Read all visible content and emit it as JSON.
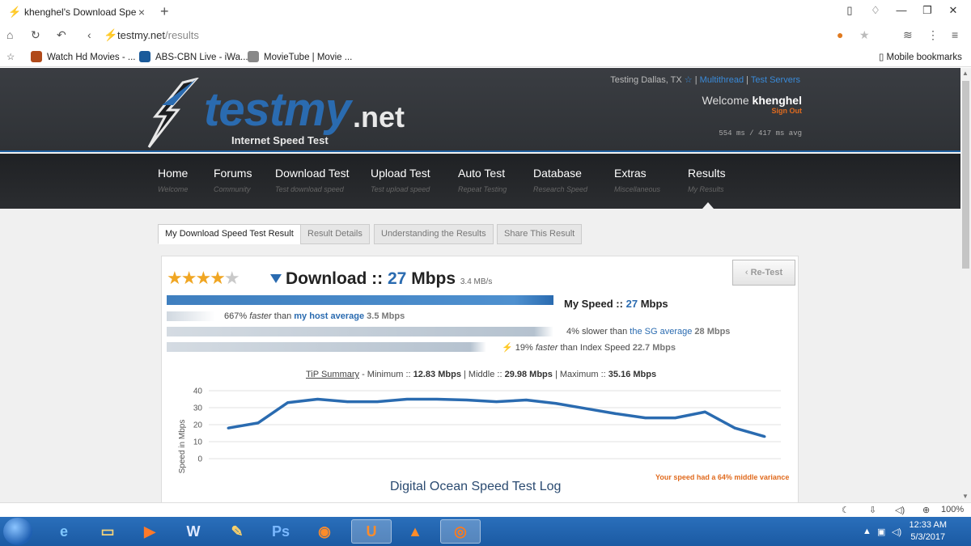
{
  "browser": {
    "tab_title": "khenghel's Download Speed T",
    "url_host": "testmy.net",
    "url_path": "/results",
    "bookmarks": [
      {
        "label": "Watch Hd Movies - ..."
      },
      {
        "label": "ABS-CBN Live - iWa..."
      },
      {
        "label": "MovieTube | Movie ..."
      }
    ],
    "mobile_bookmarks": "Mobile bookmarks",
    "zoom": "100%"
  },
  "header": {
    "logo_main": "testmy",
    "logo_net": ".net",
    "logo_sub": "Internet Speed Test",
    "testing_location": "Testing Dallas, TX",
    "multithread": "Multithread",
    "test_servers": "Test Servers",
    "welcome_prefix": "Welcome",
    "username": "khenghel",
    "sign_out": "Sign Out",
    "ping": "554 ms / 417 ms avg"
  },
  "menu": [
    {
      "label": "Home",
      "sub": "Welcome"
    },
    {
      "label": "Forums",
      "sub": "Community"
    },
    {
      "label": "Download Test",
      "sub": "Test download speed"
    },
    {
      "label": "Upload Test",
      "sub": "Test upload speed"
    },
    {
      "label": "Auto Test",
      "sub": "Repeat Testing"
    },
    {
      "label": "Database",
      "sub": "Research Speed"
    },
    {
      "label": "Extras",
      "sub": "Miscellaneous"
    },
    {
      "label": "Results",
      "sub": "My Results"
    }
  ],
  "result_tabs": [
    {
      "label": "My Download Speed Test Result",
      "active": true
    },
    {
      "label": "Result Details",
      "active": false
    },
    {
      "label": "Understanding the Results",
      "active": false
    },
    {
      "label": "Share This Result",
      "active": false
    }
  ],
  "result": {
    "rating_stars": 4.5,
    "title_prefix": "Download ::",
    "speed_value": "27",
    "speed_unit": "Mbps",
    "speed_mbs": "3.4 MB/s",
    "retest": "Re-Test",
    "my_speed_label": "My Speed ::",
    "my_speed_value": "27",
    "my_speed_unit": "Mbps",
    "host_compare": {
      "pct": "667%",
      "word": "faster",
      "mid": "than",
      "link": "my host average",
      "value": "3.5 Mbps"
    },
    "sg_compare": {
      "text": "4% slower than",
      "link": "the SG average",
      "value": "28 Mbps"
    },
    "index_compare": {
      "pct": "19%",
      "word": "faster",
      "mid": "than Index Speed",
      "value": "22.7 Mbps"
    },
    "tip_label": "TiP Summary",
    "tip_min_label": "- Minimum ::",
    "tip_min": "12.83 Mbps",
    "tip_mid_label": "| Middle ::",
    "tip_mid": "29.98 Mbps",
    "tip_max_label": "| Maximum ::",
    "tip_max": "35.16 Mbps",
    "variance_note": "Your speed had a 64% middle variance",
    "log_title": "Digital Ocean Speed Test Log"
  },
  "chart_data": {
    "type": "line",
    "ylabel": "Speed in Mbps",
    "ylim": [
      0,
      40
    ],
    "yticks": [
      0,
      10,
      20,
      30,
      40
    ],
    "grid": true,
    "series": [
      {
        "values": [
          18,
          21,
          33,
          35,
          33.5,
          33.5,
          35,
          35,
          34.5,
          33.5,
          34.5,
          32.5,
          29.5,
          26.5,
          24,
          24,
          27.5,
          18,
          13
        ]
      }
    ],
    "color": "#2a6bb0"
  },
  "taskbar": {
    "time": "12:33 AM",
    "date": "5/3/2017"
  }
}
